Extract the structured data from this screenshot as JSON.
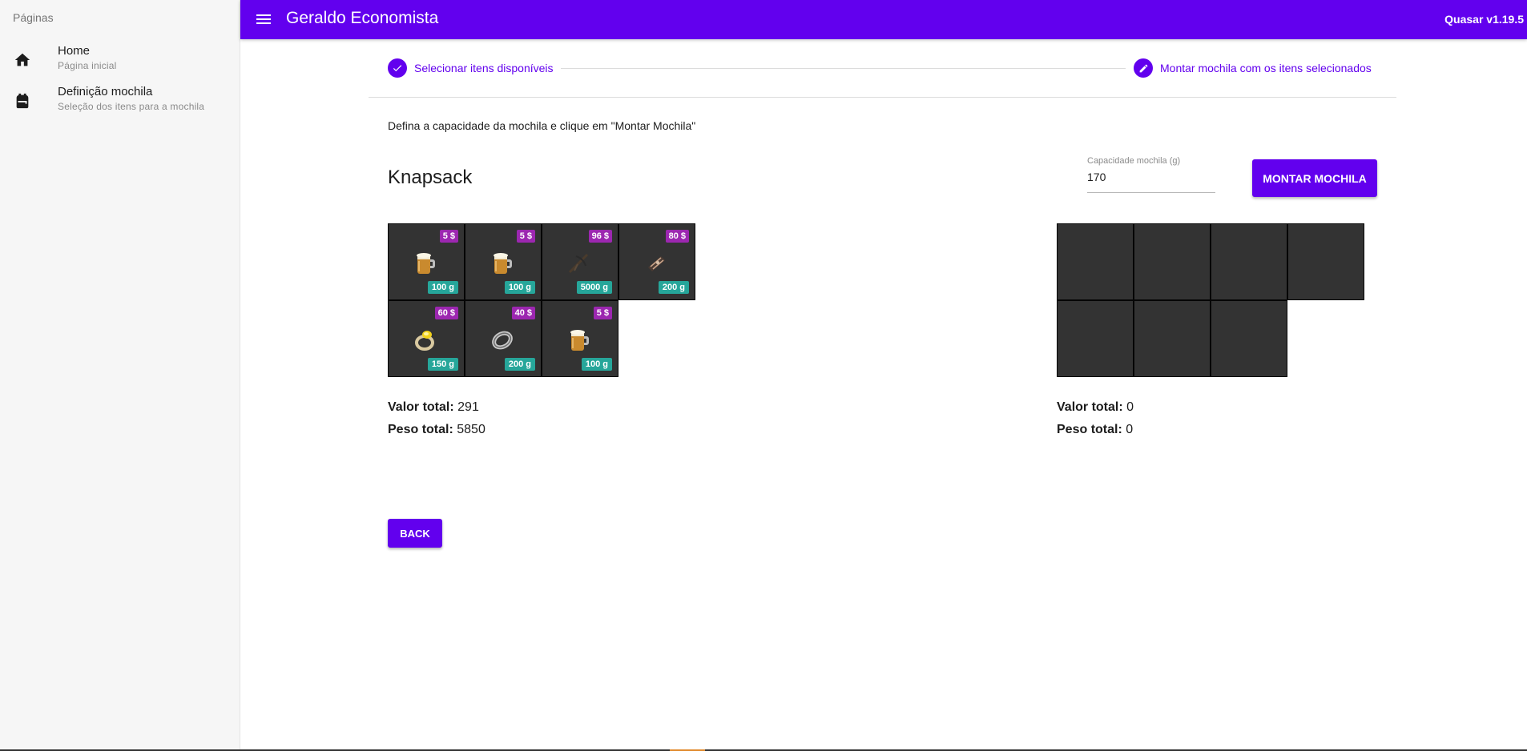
{
  "drawer": {
    "header": "Páginas",
    "items": [
      {
        "title": "Home",
        "caption": "Página inicial",
        "icon": "home-icon"
      },
      {
        "title": "Definição mochila",
        "caption": "Seleção dos itens para a mochila",
        "icon": "backpack-icon"
      }
    ]
  },
  "header": {
    "title": "Geraldo Economista",
    "version": "Quasar v1.19.5",
    "menu_icon": "menu-icon"
  },
  "stepper": {
    "steps": [
      {
        "label": "Selecionar itens disponíveis",
        "state": "done",
        "icon": "check-icon"
      },
      {
        "label": "Montar mochila com os itens selecionados",
        "state": "active",
        "icon": "edit-icon"
      }
    ]
  },
  "content": {
    "instructions": "Defina a capacidade da mochila e clique em \"Montar Mochila\"",
    "title": "Knapsack",
    "capacity": {
      "label": "Capacidade mochila (g)",
      "value": "170"
    },
    "montar_button": "MONTAR MOCHILA",
    "back_button": "BACK"
  },
  "available_items": [
    {
      "price": "5 $",
      "weight": "100 g",
      "icon": "beer-mug-icon"
    },
    {
      "price": "5 $",
      "weight": "100 g",
      "icon": "beer-mug-icon"
    },
    {
      "price": "96 $",
      "weight": "5000 g",
      "icon": "crossbow-icon"
    },
    {
      "price": "80 $",
      "weight": "200 g",
      "icon": "bracer-icon"
    },
    {
      "price": "60 $",
      "weight": "150 g",
      "icon": "gold-ring-icon"
    },
    {
      "price": "40 $",
      "weight": "200 g",
      "icon": "silver-ring-icon"
    },
    {
      "price": "5 $",
      "weight": "100 g",
      "icon": "beer-mug-icon"
    }
  ],
  "knapsack_slots": 7,
  "totals_left": {
    "value_label": "Valor total:",
    "value": "291",
    "weight_label": "Peso total:",
    "weight": "5850"
  },
  "totals_right": {
    "value_label": "Valor total:",
    "value": "0",
    "weight_label": "Peso total:",
    "weight": "0"
  },
  "colors": {
    "primary": "#6200ee",
    "price_badge": "#9c27b0",
    "weight_badge": "#26a69a",
    "cell": "#333333"
  }
}
